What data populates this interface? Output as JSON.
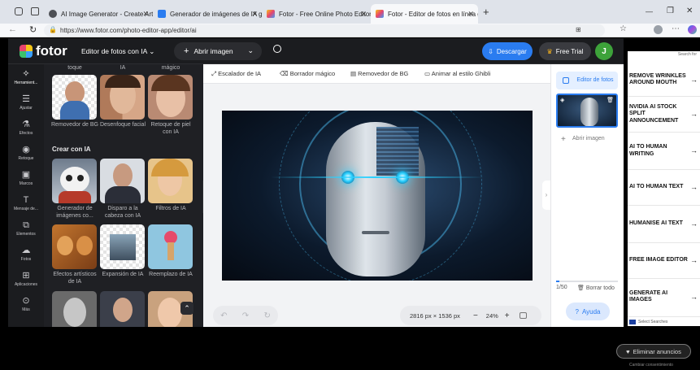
{
  "browser": {
    "tabs": [
      {
        "title": "AI Image Generator - Create Art..."
      },
      {
        "title": "Generador de imágenes de IA gr..."
      },
      {
        "title": "Fotor - Free Online Photo Editor"
      },
      {
        "title": "Fotor - Editor de fotos en línea gr..."
      }
    ],
    "url": "https://www.fotor.com/photo-editor-app/editor/ai",
    "new_tab": "+",
    "minimize": "—",
    "restore": "❐",
    "close": "✕"
  },
  "fotor": {
    "logo": "fotor",
    "menu_label": "Editor de fotos con IA",
    "open_image": "Abrir imagen",
    "download": "Descargar",
    "free_trial": "Free Trial",
    "avatar": "J"
  },
  "rail": [
    {
      "label": "Herramient...",
      "icon": "wand-icon"
    },
    {
      "label": "Ajustar",
      "icon": "sliders-icon"
    },
    {
      "label": "Efectos",
      "icon": "flask-icon"
    },
    {
      "label": "Retoque",
      "icon": "eye-icon"
    },
    {
      "label": "Marcos",
      "icon": "frame-icon"
    },
    {
      "label": "Mensaje de...",
      "icon": "text-icon"
    },
    {
      "label": "Elementos",
      "icon": "shapes-icon"
    },
    {
      "label": "Fotos",
      "icon": "cloud-icon"
    },
    {
      "label": "Aplicaciones",
      "icon": "apps-icon"
    },
    {
      "label": "Más",
      "icon": "more-icon"
    }
  ],
  "panel": {
    "top_labels": [
      "toque",
      "IA",
      "mágico"
    ],
    "row1": [
      {
        "label": "Removedor de BG"
      },
      {
        "label": "Desenfoque facial"
      },
      {
        "label": "Retoque de piel con IA"
      }
    ],
    "section_title": "Crear con IA",
    "row2": [
      {
        "label": "Generador de imágenes co..."
      },
      {
        "label": "Disparo a la cabeza con IA"
      },
      {
        "label": "Filtros de IA"
      }
    ],
    "row3": [
      {
        "label": "Efectos artísticos de IA"
      },
      {
        "label": "Expansión de IA"
      },
      {
        "label": "Reemplazo de IA"
      }
    ]
  },
  "toolbar": {
    "tools": [
      {
        "label": "Escalador de IA"
      },
      {
        "label": "Borrador mágico"
      },
      {
        "label": "Removedor de BG"
      },
      {
        "label": "Animar al estilo Ghibli"
      }
    ]
  },
  "canvas": {
    "dimensions": "2816 px × 1536 px",
    "zoom": "24%",
    "zoom_out": "−",
    "zoom_in": "+"
  },
  "right_panel": {
    "editor_label": "Editor de fotos",
    "add_image": "Abrir imagen",
    "page_count": "1/50",
    "delete_all": "Borrar todo",
    "help": "Ayuda"
  },
  "ad": {
    "search_label": "Search for",
    "items": [
      {
        "label": "REMOVE WRINKLES AROUND MOUTH"
      },
      {
        "label": "NVIDIA AI STOCK SPLIT ANNOUNCEMENT"
      },
      {
        "label": "AI TO HUMAN WRITING"
      },
      {
        "label": "AI TO HUMAN TEXT"
      },
      {
        "label": "HUMANISE AI TEXT"
      },
      {
        "label": "FREE IMAGE EDITOR"
      },
      {
        "label": "GENERATE AI IMAGES"
      }
    ],
    "footer": "Select Searches",
    "remove_ads": "Eliminar anuncios",
    "consent": "Cambiar consentimiento"
  },
  "colors": {
    "accent_blue": "#2a7cf0",
    "free_trial_bg": "#3a3b40",
    "avatar_bg": "#3da23a",
    "dark_bg": "#1b1c1f"
  }
}
